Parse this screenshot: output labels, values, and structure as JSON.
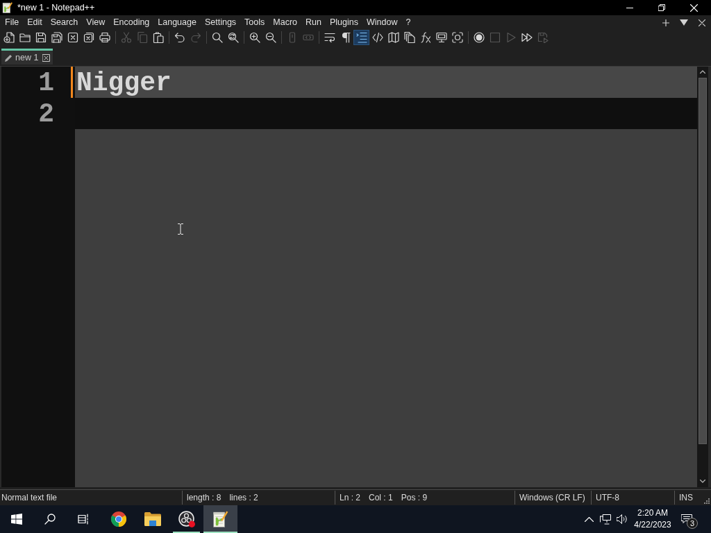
{
  "window": {
    "title": "*new 1 - Notepad++"
  },
  "menu": [
    "File",
    "Edit",
    "Search",
    "View",
    "Encoding",
    "Language",
    "Settings",
    "Tools",
    "Macro",
    "Run",
    "Plugins",
    "Window",
    "?"
  ],
  "toolbar": [
    [
      {
        "disabled": false,
        "on": false
      },
      {
        "disabled": false,
        "on": false
      },
      {
        "disabled": false,
        "on": false
      },
      {
        "disabled": false,
        "on": false
      },
      {
        "disabled": false,
        "on": false
      },
      {
        "disabled": false,
        "on": false
      },
      {
        "disabled": false,
        "on": false
      }
    ],
    [
      {
        "disabled": true,
        "on": false
      },
      {
        "disabled": true,
        "on": false
      },
      {
        "disabled": false,
        "on": false
      }
    ],
    [
      {
        "disabled": false,
        "on": false
      },
      {
        "disabled": true,
        "on": false
      }
    ],
    [
      {
        "disabled": false,
        "on": false
      },
      {
        "disabled": false,
        "on": false
      }
    ],
    [
      {
        "disabled": false,
        "on": false
      },
      {
        "disabled": false,
        "on": false
      }
    ],
    [
      {
        "disabled": true,
        "on": false
      },
      {
        "disabled": true,
        "on": false
      }
    ],
    [
      {
        "disabled": false,
        "on": false
      },
      {
        "disabled": false,
        "on": false
      },
      {
        "disabled": false,
        "on": true
      },
      {
        "disabled": false,
        "on": false
      },
      {
        "disabled": false,
        "on": false
      },
      {
        "disabled": false,
        "on": false
      },
      {
        "disabled": false,
        "on": false
      },
      {
        "disabled": false,
        "on": false
      },
      {
        "disabled": false,
        "on": false
      }
    ],
    [
      {
        "disabled": false,
        "on": false
      },
      {
        "disabled": true,
        "on": false
      },
      {
        "disabled": true,
        "on": false
      },
      {
        "disabled": false,
        "on": false
      },
      {
        "disabled": true,
        "on": false
      }
    ]
  ],
  "tabs": [
    {
      "label": "new 1",
      "selected": true,
      "modified": true
    }
  ],
  "editor": {
    "lines": [
      {
        "number": "1",
        "text": "Nigger",
        "modified": true,
        "current": false
      },
      {
        "number": "2",
        "modified": false,
        "current": true
      }
    ]
  },
  "status_bar": [
    [
      "Normal text file"
    ],
    [
      "length : 8",
      "lines : 2"
    ],
    [
      "Ln : 2",
      "Col : 1",
      "Pos : 9"
    ],
    [
      "Windows (CR LF)"
    ],
    [
      "UTF-8"
    ],
    [
      "INS"
    ]
  ],
  "taskbar": {
    "apps": [
      {
        "running": false,
        "selected": false
      },
      {
        "running": false,
        "selected": false
      },
      {
        "running": true,
        "selected": false
      },
      {
        "running": true,
        "selected": true
      }
    ],
    "clock": {
      "time": "2:20 AM",
      "date": "4/22/2023"
    },
    "notification_count": "3"
  }
}
